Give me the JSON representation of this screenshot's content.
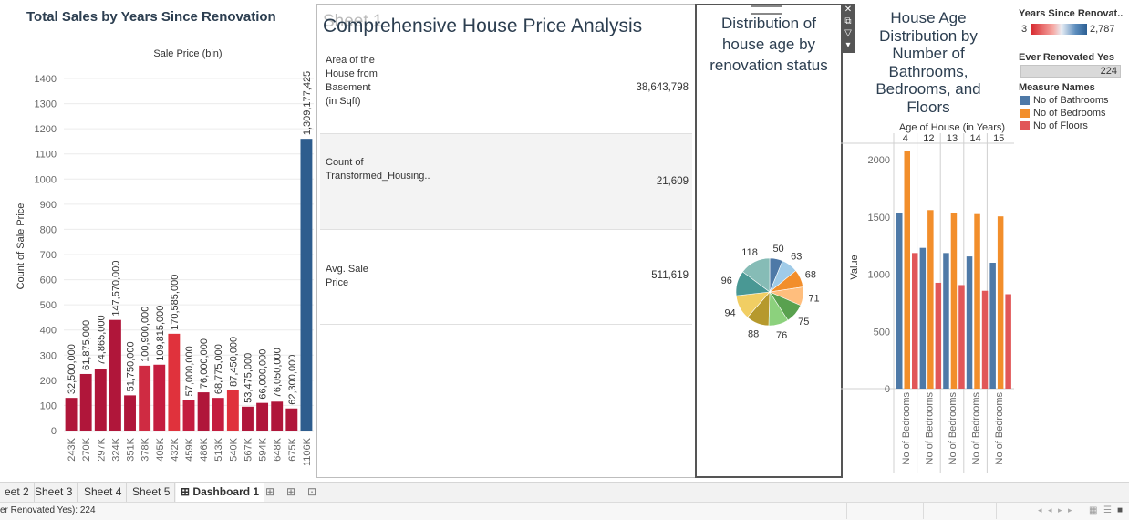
{
  "sales_chart": {
    "title": "Total Sales by Years Since Renovation",
    "header": "Sale Price (bin)",
    "ylabel": "Count of Sale Price"
  },
  "kpi": {
    "ghost_title": "Sheet 1",
    "title": "Comprehensive House Price Analysis",
    "rows": [
      {
        "label": "Area of the House from Basement (in Sqft)",
        "value": "38,643,798"
      },
      {
        "label": "Count of Transformed_Housing..",
        "value": "21,609"
      },
      {
        "label": "Avg. Sale Price",
        "value": "511,619"
      }
    ]
  },
  "pie": {
    "title": "Distribution of house age by renovation status"
  },
  "age_chart": {
    "title": "House Age Distribution by Number of Bathrooms, Bedrooms, and Floors",
    "header": "Age of House (in Years)",
    "ylabel": "Value",
    "xlabel_per_group": "No of Bedrooms"
  },
  "legend": {
    "color_title": "Years Since Renovat..",
    "color_min": "3",
    "color_max": "2,787",
    "filter_title": "Ever Renovated Yes",
    "filter_value": "224",
    "measure_title": "Measure Names",
    "measures": [
      {
        "label": "No of Bathrooms",
        "color": "#4e79a7"
      },
      {
        "label": "No of Bedrooms",
        "color": "#f28e2b"
      },
      {
        "label": "No of Floors",
        "color": "#e15759"
      }
    ]
  },
  "tabs": [
    "eet 2",
    "Sheet 3",
    "Sheet 4",
    "Sheet 5",
    "Dashboard 1"
  ],
  "tab_icon": "dashboard-icon",
  "status_text": "er Renovated Yes): 224",
  "chart_data": [
    {
      "type": "bar",
      "title": "Total Sales by Years Since Renovation",
      "xlabel": "Sale Price (bin)",
      "ylabel": "Count of Sale Price",
      "ylim": [
        0,
        1400
      ],
      "yticks": [
        0,
        100,
        200,
        300,
        400,
        500,
        600,
        700,
        800,
        900,
        1000,
        1100,
        1200,
        1300,
        1400
      ],
      "categories": [
        "243K",
        "270K",
        "297K",
        "324K",
        "351K",
        "378K",
        "405K",
        "432K",
        "459K",
        "486K",
        "513K",
        "540K",
        "567K",
        "594K",
        "648K",
        "675K",
        "1106K"
      ],
      "values": [
        130,
        225,
        245,
        440,
        140,
        258,
        262,
        385,
        122,
        152,
        130,
        160,
        95,
        110,
        115,
        88,
        1160
      ],
      "labels": [
        "32,500,000",
        "61,875,000",
        "74,865,000",
        "147,570,000",
        "51,750,000",
        "100,900,000",
        "109,815,000",
        "170,585,000",
        "57,000,000",
        "76,000,000",
        "68,775,000",
        "87,450,000",
        "53,475,000",
        "66,000,000",
        "76,050,000",
        "62,300,000",
        "1,309,177,425"
      ],
      "colors": [
        "#b0163a",
        "#b0163a",
        "#b0163a",
        "#b0163a",
        "#b0163a",
        "#cf2b42",
        "#c41d3f",
        "#e0323c",
        "#c41d3f",
        "#b0163a",
        "#c41d3f",
        "#e0323c",
        "#b0163a",
        "#b0163a",
        "#b0163a",
        "#b0163a",
        "#2e5d8e"
      ],
      "grid": true
    },
    {
      "type": "pie",
      "title": "Distribution of house age by renovation status",
      "values": [
        50,
        63,
        68,
        71,
        75,
        76,
        88,
        94,
        96,
        118
      ],
      "colors": [
        "#4e79a7",
        "#a0cbe8",
        "#f28e2b",
        "#ffbe7d",
        "#59a14f",
        "#8cd17d",
        "#b6992d",
        "#f1ce63",
        "#499894",
        "#86bcb6",
        "#e15759",
        "#ff9d9a"
      ]
    },
    {
      "type": "bar",
      "title": "House Age Distribution by Number of Bathrooms, Bedrooms, and Floors",
      "xlabel": "Age of House (in Years)",
      "ylabel": "Value",
      "ylim": [
        0,
        2200
      ],
      "yticks": [
        0,
        500,
        1000,
        1500,
        2000
      ],
      "categories": [
        "4",
        "12",
        "13",
        "14",
        "15"
      ],
      "series": [
        {
          "name": "No of Bathrooms",
          "values": [
            1535,
            1230,
            1185,
            1155,
            1100
          ]
        },
        {
          "name": "No of Bedrooms",
          "values": [
            2080,
            1560,
            1535,
            1525,
            1505
          ]
        },
        {
          "name": "No of Floors",
          "values": [
            1185,
            925,
            905,
            855,
            825
          ]
        }
      ]
    }
  ]
}
